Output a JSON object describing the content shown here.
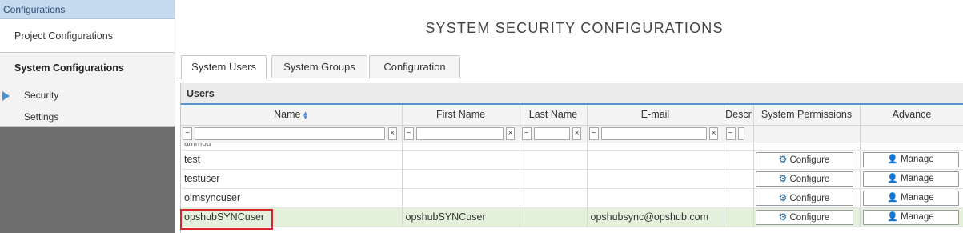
{
  "sidebar": {
    "header": "Configurations",
    "project_configurations": "Project Configurations",
    "system_configurations": "System Configurations",
    "security": "Security",
    "settings": "Settings"
  },
  "page": {
    "title": "SYSTEM SECURITY CONFIGURATIONS"
  },
  "tabs": [
    "System Users",
    "System Groups",
    "Configuration"
  ],
  "grid": {
    "caption": "Users",
    "columns": [
      "Name",
      "First Name",
      "Last Name",
      "E-mail",
      "Descr",
      "System Permissions",
      "Advance"
    ],
    "partial_row_name": "ammpu",
    "rows": [
      {
        "name": "test",
        "first": "",
        "last": "",
        "email": "",
        "desc": ""
      },
      {
        "name": "testuser",
        "first": "",
        "last": "",
        "email": "",
        "desc": ""
      },
      {
        "name": "oimsyncuser",
        "first": "",
        "last": "",
        "email": "",
        "desc": ""
      },
      {
        "name": "opshubSYNCuser",
        "first": "opshubSYNCuser",
        "last": "",
        "email": "opshubsync@opshub.com",
        "desc": ""
      }
    ],
    "configure_label": "Configure",
    "manage_label": "Manage",
    "filter_op": "~",
    "filter_clear": "×"
  },
  "colors": {
    "accent": "#4a90d9",
    "selected_row": "#e3f1dc",
    "highlight_border": "#d9262b",
    "sidebar_header": "#c5d9ef"
  }
}
